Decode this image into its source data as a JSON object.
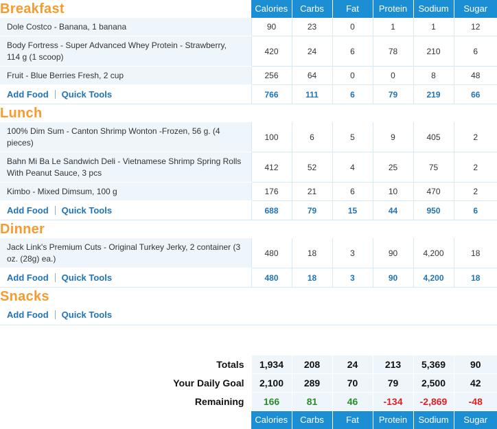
{
  "columns": [
    "Calories",
    "Carbs",
    "Fat",
    "Protein",
    "Sodium",
    "Sugar"
  ],
  "actions": {
    "add_food": "Add Food",
    "quick_tools": "Quick Tools"
  },
  "meals": [
    {
      "title": "Breakfast",
      "foods": [
        {
          "name": "Dole Costco - Banana, 1 banana",
          "values": [
            "90",
            "23",
            "0",
            "1",
            "1",
            "12"
          ]
        },
        {
          "name": "Body Fortress - Super Advanced Whey Protein - Strawberry, 114 g (1 scoop)",
          "values": [
            "420",
            "24",
            "6",
            "78",
            "210",
            "6"
          ]
        },
        {
          "name": "Fruit - Blue Berries Fresh, 2 cup",
          "values": [
            "256",
            "64",
            "0",
            "0",
            "8",
            "48"
          ]
        }
      ],
      "totals": [
        "766",
        "111",
        "6",
        "79",
        "219",
        "66"
      ]
    },
    {
      "title": "Lunch",
      "foods": [
        {
          "name": "100% Dim Sum - Canton Shrimp Wonton -Frozen, 56 g. (4 pieces)",
          "values": [
            "100",
            "6",
            "5",
            "9",
            "405",
            "2"
          ]
        },
        {
          "name": "Bahn Mi Ba Le Sandwich Deli - Vietnamese Shrimp Spring Rolls With Peanut Sauce, 3 pcs",
          "values": [
            "412",
            "52",
            "4",
            "25",
            "75",
            "2"
          ]
        },
        {
          "name": "Kimbo - Mixed Dimsum, 100 g",
          "values": [
            "176",
            "21",
            "6",
            "10",
            "470",
            "2"
          ]
        }
      ],
      "totals": [
        "688",
        "79",
        "15",
        "44",
        "950",
        "6"
      ]
    },
    {
      "title": "Dinner",
      "foods": [
        {
          "name": "Jack Link's Premium Cuts - Original Turkey Jerky, 2 container (3 oz. (28g) ea.)",
          "values": [
            "480",
            "18",
            "3",
            "90",
            "4,200",
            "18"
          ]
        }
      ],
      "totals": [
        "480",
        "18",
        "3",
        "90",
        "4,200",
        "18"
      ]
    },
    {
      "title": "Snacks",
      "foods": [],
      "totals": null
    }
  ],
  "summary": {
    "totals_label": "Totals",
    "totals": [
      "1,934",
      "208",
      "24",
      "213",
      "5,369",
      "90"
    ],
    "goal_label": "Your Daily Goal",
    "goal": [
      "2,100",
      "289",
      "70",
      "79",
      "2,500",
      "42"
    ],
    "remaining_label": "Remaining",
    "remaining": [
      "166",
      "81",
      "46",
      "-134",
      "-2,869",
      "-48"
    ]
  },
  "colors": {
    "section_title": "#f89a2e",
    "header_bg": "#1c8fd4",
    "link": "#1f73b7",
    "positive": "#2a8a2a",
    "negative": "#e02020"
  }
}
